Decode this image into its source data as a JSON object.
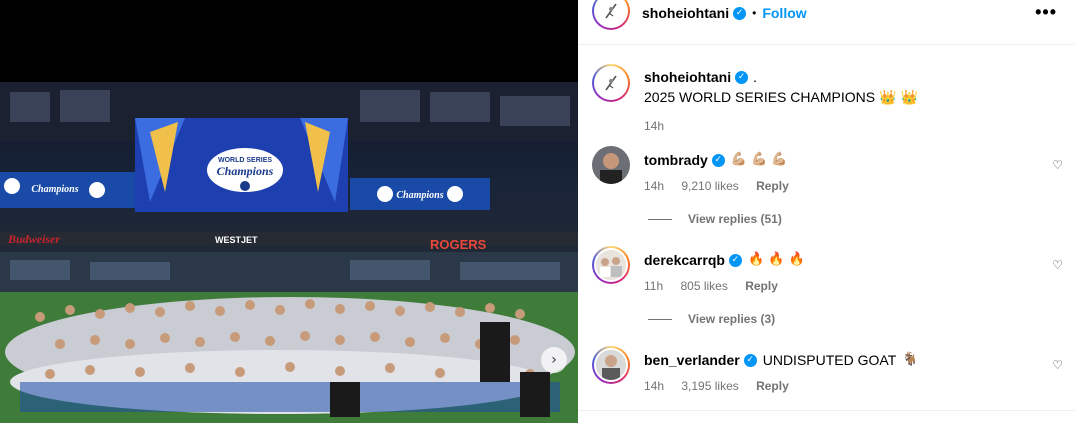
{
  "post": {
    "author": "shoheiohtani",
    "follow_label": "Follow",
    "dot": "•",
    "more": "•••"
  },
  "caption": {
    "author": "shoheiohtani",
    "suffix": ".",
    "text": "2025 WORLD SERIES CHAMPIONS",
    "emoji": "👑 👑",
    "time": "14h"
  },
  "comments": [
    {
      "user": "tombrady",
      "text": "",
      "emoji": "💪🏼 💪🏼 💪🏼",
      "time": "14h",
      "likes": "9,210 likes",
      "reply": "Reply",
      "replies": "View replies (51)"
    },
    {
      "user": "derekcarrqb",
      "text": "",
      "emoji": "🔥 🔥 🔥",
      "time": "11h",
      "likes": "805 likes",
      "reply": "Reply",
      "replies": "View replies (3)"
    },
    {
      "user": "ben_verlander",
      "text": "UNDISPUTED GOAT",
      "emoji": "🐐",
      "time": "14h",
      "likes": "3,195 likes",
      "reply": "Reply",
      "replies": ""
    }
  ],
  "photo": {
    "scoreboard_text": "Champions",
    "scoreboard_sub": "WORLD SERIES",
    "sponsor_left": "Budweiser",
    "sponsor_right": "ROGERS",
    "sponsor_mid": "WESTJET",
    "banner": "2025 WORLD SERIES Champions",
    "logo_letters": "LA"
  },
  "colors": {
    "link": "#0095f6",
    "muted": "#737373",
    "dodger_blue": "#1a4aa8"
  }
}
